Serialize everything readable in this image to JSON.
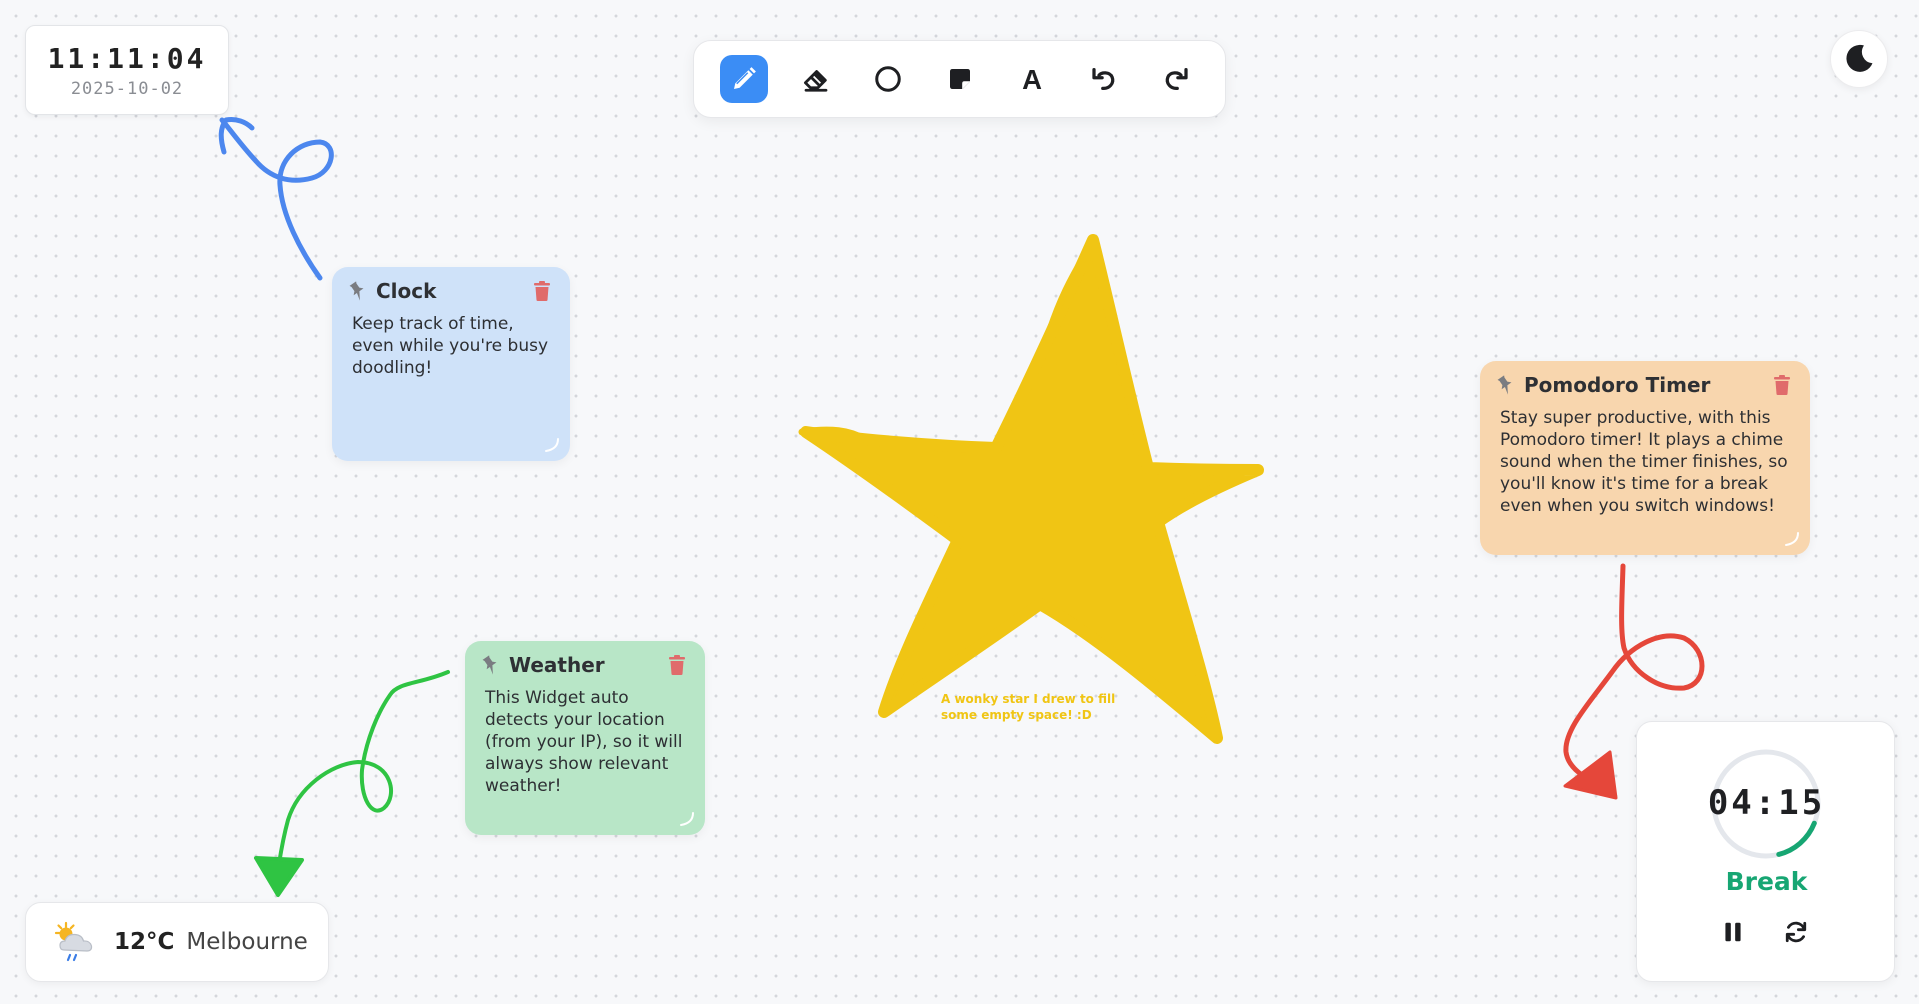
{
  "clock": {
    "time": "11:11:04",
    "date": "2025-10-02"
  },
  "toolbar": {
    "tools": [
      {
        "name": "pencil-icon",
        "active": true
      },
      {
        "name": "eraser-icon",
        "active": false
      },
      {
        "name": "circle-icon",
        "active": false
      },
      {
        "name": "sticky-note-icon",
        "active": false
      },
      {
        "name": "text-icon",
        "active": false,
        "glyph": "A"
      },
      {
        "name": "undo-icon",
        "active": false
      },
      {
        "name": "redo-icon",
        "active": false
      }
    ],
    "active_color": "#3b8df5"
  },
  "theme_toggle": {
    "icon": "moon-icon"
  },
  "notes": {
    "clock": {
      "title": "Clock",
      "body": "Keep track of time, even while you're busy doodling!",
      "color": "#cfe2f9"
    },
    "weather": {
      "title": "Weather",
      "body": "This Widget auto detects your location (from your IP), so it will always show relevant weather!",
      "color": "#b8e6c7"
    },
    "pomodoro": {
      "title": "Pomodoro Timer",
      "body": "Stay super productive, with this Pomodoro timer! It plays a chime sound when the timer finishes, so you'll know it's time for a break even when you switch windows!",
      "color": "#f8d6ae"
    }
  },
  "drawing": {
    "star_caption": "A wonky star I drew to fill some empty space! :D",
    "colors": {
      "star": "#f0c514",
      "blue": "#4c87ee",
      "green": "#2fc443",
      "red": "#e5473a"
    }
  },
  "weather": {
    "icon": "partly-cloudy-rain-icon",
    "temperature": "12°C",
    "city": "Melbourne"
  },
  "pomodoro": {
    "time": "04:15",
    "mode": "Break",
    "progress": 0.15,
    "accent": "#17a673"
  }
}
